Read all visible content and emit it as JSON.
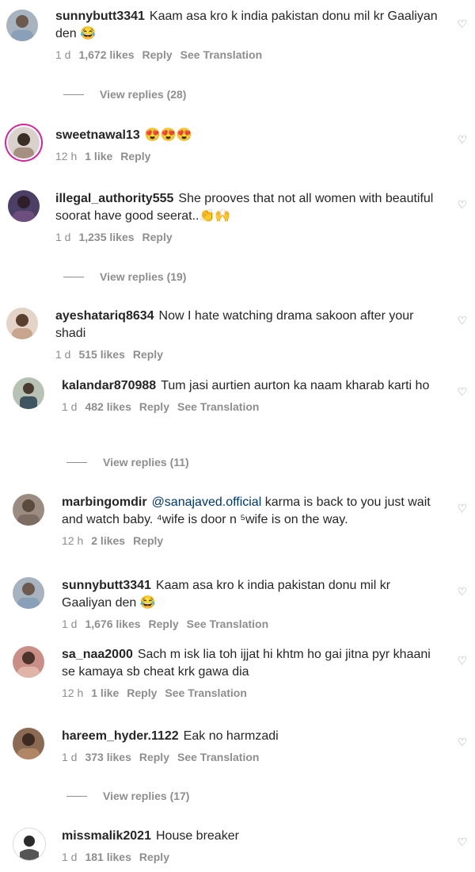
{
  "comments": [
    {
      "user": "sunnybutt3341",
      "text": "Kaam asa kro k india pakistan donu mil kr Gaaliyan den 😂",
      "time": "1 d",
      "likes": "1,672 likes",
      "reply": "Reply",
      "translation": "See Translation",
      "view_replies": "View replies (28)"
    },
    {
      "user": "sweetnawal13",
      "text": "😍😍😍",
      "time": "12 h",
      "likes": "1 like",
      "reply": "Reply"
    },
    {
      "user": "illegal_authority555",
      "text": "She prooves that not all women with beautiful soorat have good seerat..👏🙌",
      "time": "1 d",
      "likes": "1,235 likes",
      "reply": "Reply",
      "view_replies": "View replies (19)"
    },
    {
      "user": "ayeshatariq8634",
      "text": "Now I hate watching drama sakoon after your shadi",
      "time": "1 d",
      "likes": "515 likes",
      "reply": "Reply"
    },
    {
      "user": "kalandar870988",
      "text": "Tum jasi aurtien aurton ka naam kharab karti ho",
      "time": "1 d",
      "likes": "482 likes",
      "reply": "Reply",
      "translation": "See Translation",
      "view_replies": "View replies (11)"
    },
    {
      "user": "marbingomdir",
      "mention": "@sanajaved.official",
      "text": "karma is back to you just wait and watch baby. ⁴wife is door n ⁵wife is on the way.",
      "time": "12 h",
      "likes": "2 likes",
      "reply": "Reply"
    },
    {
      "user": "sunnybutt3341",
      "text": "Kaam asa kro k india pakistan donu mil kr Gaaliyan den 😂",
      "time": "1 d",
      "likes": "1,676 likes",
      "reply": "Reply",
      "translation": "See Translation"
    },
    {
      "user": "sa_naa2000",
      "text": "Sach m isk lia toh ijjat hi khtm ho gai jitna pyr khaani se kamaya sb cheat krk gawa dia",
      "time": "12 h",
      "likes": "1 like",
      "reply": "Reply",
      "translation": "See Translation"
    },
    {
      "user": "hareem_hyder.1122",
      "text": "Eak no harmzadi",
      "time": "1 d",
      "likes": "373 likes",
      "reply": "Reply",
      "translation": "See Translation",
      "view_replies": "View replies (17)"
    },
    {
      "user": "missmalik2021",
      "text": "House breaker",
      "time": "1 d",
      "likes": "181 likes",
      "reply": "Reply"
    }
  ],
  "icons": {
    "like": "heart-outline-icon",
    "avatar": "user-avatar"
  }
}
